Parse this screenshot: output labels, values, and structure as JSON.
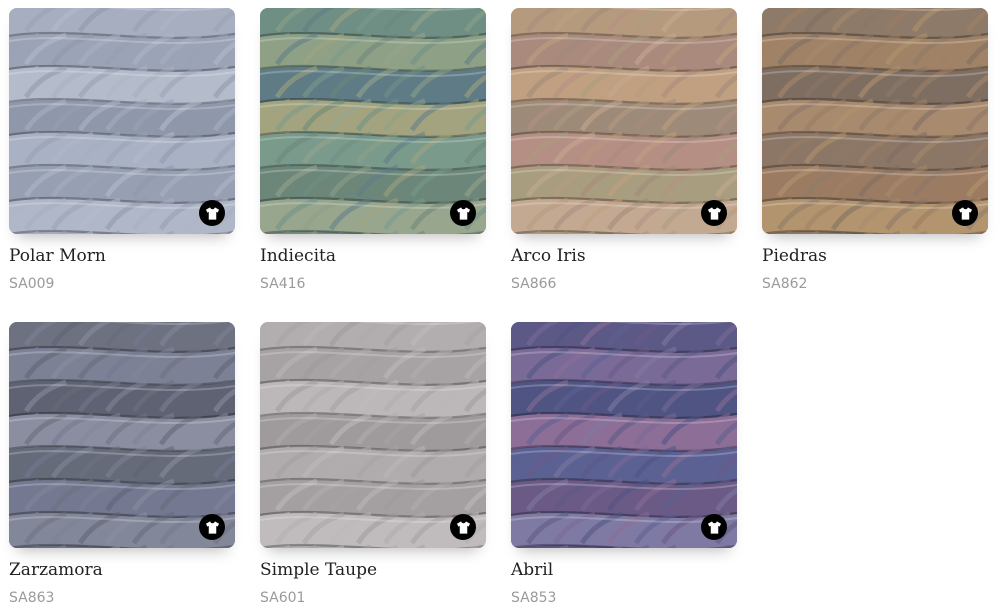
{
  "colors": [
    {
      "name": "Polar Morn",
      "code": "SA009",
      "palette": [
        "#a6aec0",
        "#9ba3b6",
        "#b4bbcb",
        "#8f97ab",
        "#a9b1c4",
        "#979fb3",
        "#b0b7c8"
      ],
      "badge_icon": "tshirt-icon"
    },
    {
      "name": "Indiecita",
      "code": "SA416",
      "palette": [
        "#6f8f85",
        "#8ea086",
        "#5f7c86",
        "#a3a47f",
        "#7a9a8c",
        "#6c8679",
        "#98a68e"
      ],
      "badge_icon": "tshirt-icon"
    },
    {
      "name": "Arco Iris",
      "code": "SA866",
      "palette": [
        "#b69a7e",
        "#a98a7c",
        "#c0a080",
        "#9e8a78",
        "#b58f84",
        "#a99d7f",
        "#c4a992"
      ],
      "badge_icon": "tshirt-icon"
    },
    {
      "name": "Piedras",
      "code": "SA862",
      "palette": [
        "#8e7a68",
        "#a08266",
        "#7e6e62",
        "#a88a6e",
        "#8c7767",
        "#9b7c63",
        "#b2946e"
      ],
      "badge_icon": "tshirt-icon"
    },
    {
      "name": "Zarzamora",
      "code": "SA863",
      "palette": [
        "#6d7180",
        "#7d8196",
        "#5f6272",
        "#8a8ea0",
        "#666b7a",
        "#747890",
        "#83879a"
      ],
      "badge_icon": "tshirt-icon"
    },
    {
      "name": "Simple Taupe",
      "code": "SA601",
      "palette": [
        "#b2adae",
        "#a7a2a4",
        "#bcb7b8",
        "#9f9a9c",
        "#b0abac",
        "#a4a0a2",
        "#c0bcbd"
      ],
      "badge_icon": "tshirt-icon"
    },
    {
      "name": "Abril",
      "code": "SA853",
      "palette": [
        "#5d5987",
        "#7a6a98",
        "#4f5483",
        "#8c6e97",
        "#5b6192",
        "#6c5a86",
        "#7f7aa3"
      ],
      "badge_icon": "tshirt-icon"
    }
  ]
}
